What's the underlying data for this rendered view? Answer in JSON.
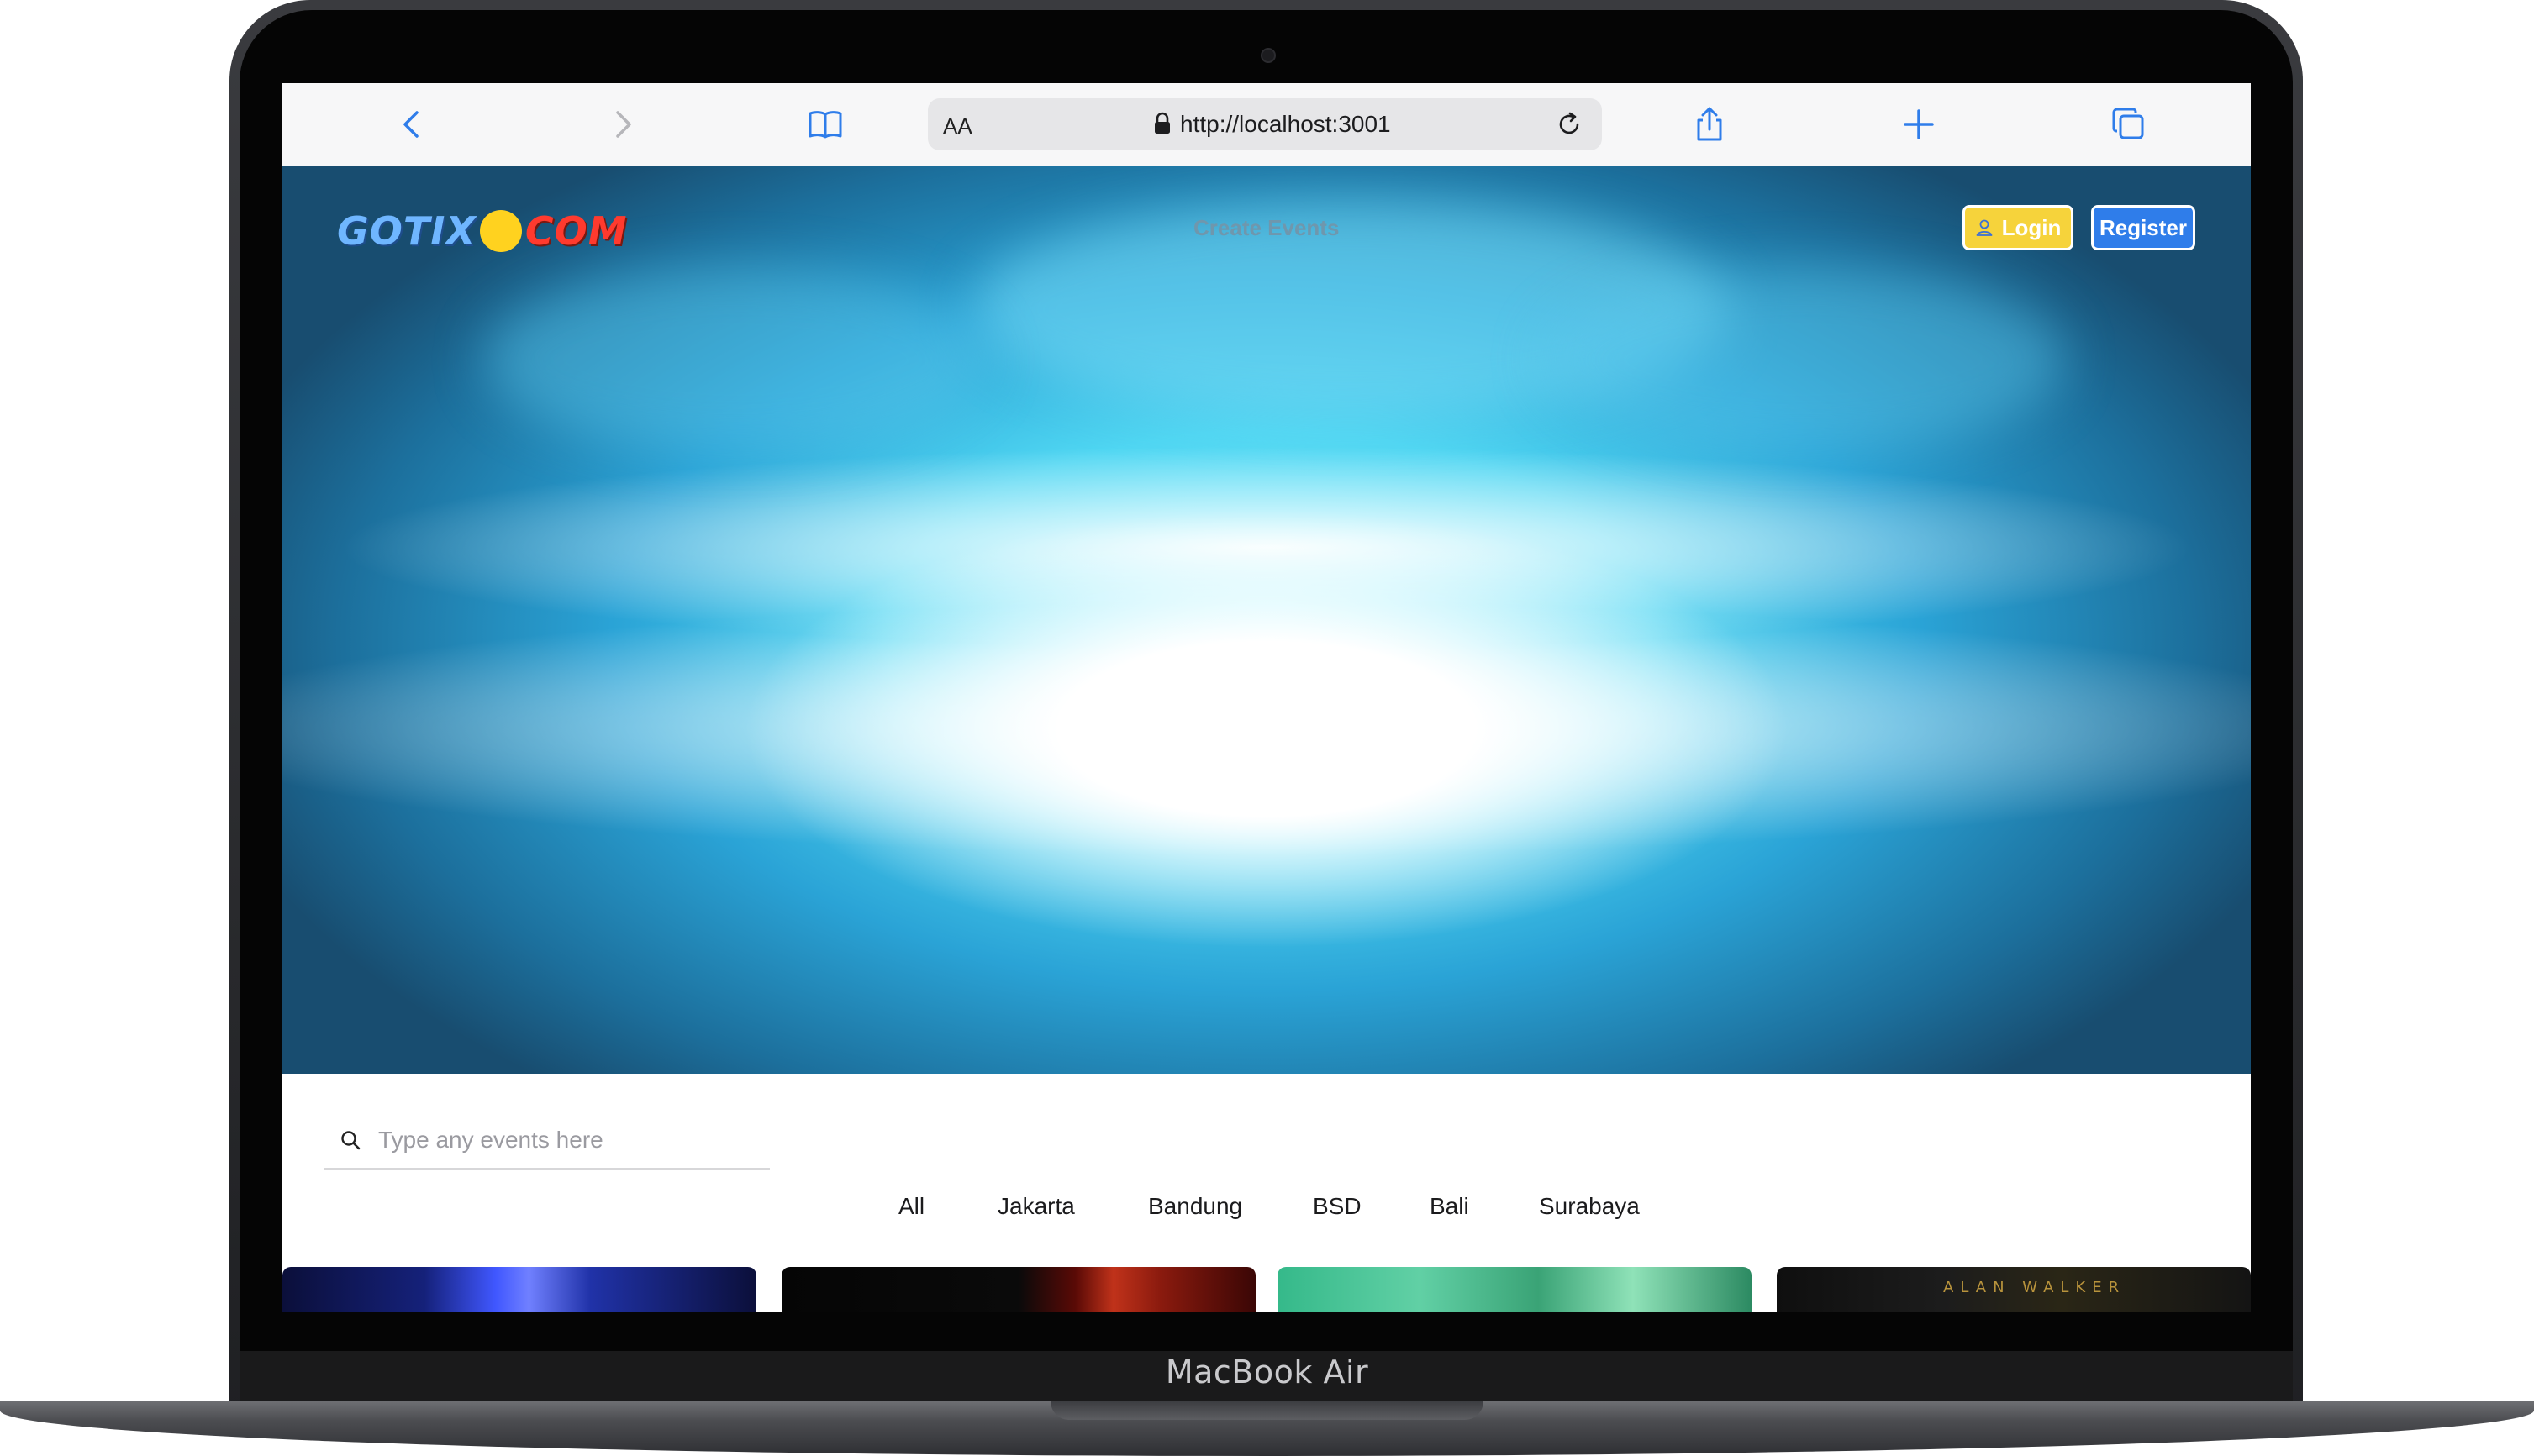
{
  "device": {
    "label": "MacBook Air"
  },
  "browser": {
    "text_size_label": "AA",
    "url": "http://localhost:3001",
    "icons": {
      "back": "chevron-left-icon",
      "forward": "chevron-right-icon",
      "bookmarks": "book-icon",
      "lock": "lock-icon",
      "reload": "reload-icon",
      "share": "share-icon",
      "new_tab": "plus-icon",
      "tabs": "tabs-icon"
    },
    "accent_color": "#2f7dea"
  },
  "header": {
    "logo": {
      "part_a": "GOTIX",
      "part_b": "COM"
    },
    "nav_create": "Create Events",
    "login_label": "Login",
    "register_label": "Register",
    "colors": {
      "login_bg": "#f6d33b",
      "register_bg": "#2f7dea"
    }
  },
  "search": {
    "placeholder": "Type any events here",
    "value": ""
  },
  "filters": [
    "All",
    "Jakarta",
    "Bandung",
    "BSD",
    "Bali",
    "Surabaya"
  ],
  "cards": [
    {
      "title": ""
    },
    {
      "title": ""
    },
    {
      "title": ""
    },
    {
      "title": "ALAN WALKER"
    }
  ]
}
